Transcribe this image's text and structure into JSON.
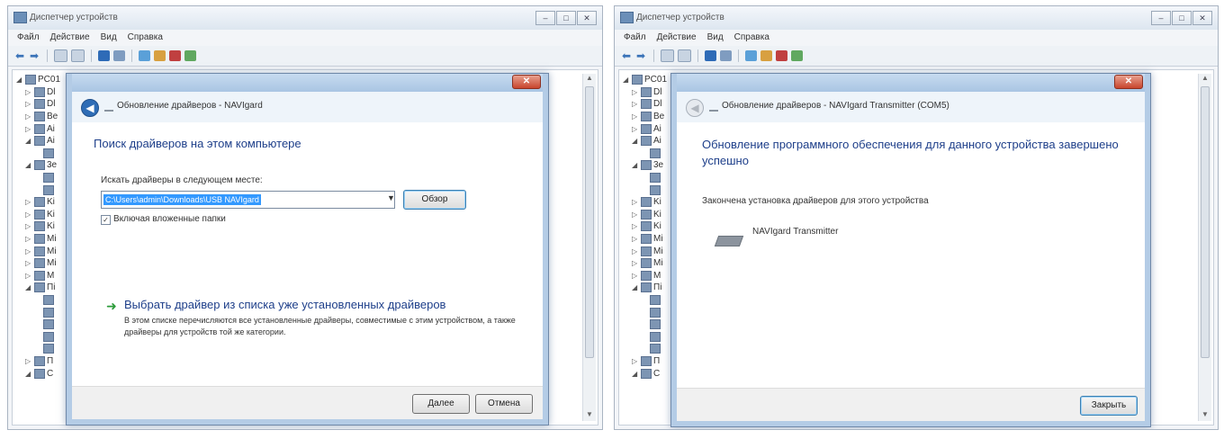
{
  "window": {
    "title": "Диспетчер устройств",
    "menu": [
      "Файл",
      "Действие",
      "Вид",
      "Справка"
    ],
    "controls": [
      "–",
      "□",
      "✕"
    ]
  },
  "tree": {
    "root": "PC01",
    "items": [
      "Dl",
      "Dl",
      "Be",
      "Ai",
      "Ai",
      "",
      "3e",
      "",
      "",
      "Ki",
      "Ki",
      "Ki",
      "Mi",
      "Mi",
      "Mi",
      "M",
      "Πi",
      "",
      "",
      "",
      "",
      "",
      "Π",
      "C"
    ]
  },
  "dialog_left": {
    "title": "Обновление драйверов - NAVIgard",
    "close": "✕",
    "back": "◀",
    "heading": "Поиск драйверов на этом компьютере",
    "search_label": "Искать драйверы в следующем месте:",
    "path_value": "C:\\Users\\admin\\Downloads\\USB NAVIgard",
    "browse_button": "Обзор",
    "include_subfolders": "Включая вложенные папки",
    "checkbox_mark": "✓",
    "pick_title": "Выбрать драйвер из списка уже установленных драйверов",
    "pick_desc": "В этом списке перечисляются все установленные драйверы, совместимые с этим устройством, а также драйверы для устройств той же категории.",
    "next_button": "Далее",
    "cancel_button": "Отмена"
  },
  "dialog_right": {
    "title": "Обновление драйверов - NAVIgard Transmitter (COM5)",
    "close": "✕",
    "back": "◀",
    "heading": "Обновление программного обеспечения для данного устройства завершено успешно",
    "finished_text": "Закончена установка драйверов для этого устройства",
    "device_name": "NAVIgard Transmitter",
    "close_button": "Закрыть"
  }
}
